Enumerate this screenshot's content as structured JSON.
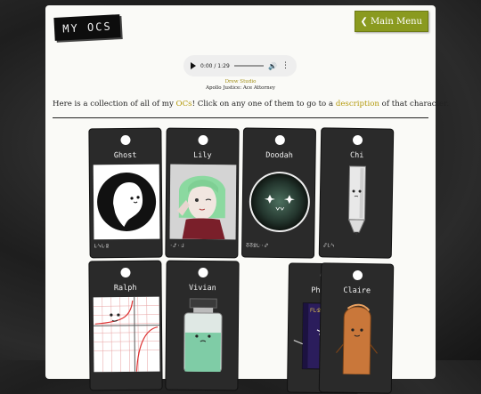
{
  "header": {
    "logo_text": "MY OCS",
    "main_menu_label": "Main Menu",
    "main_menu_icon": "chevron-left-icon"
  },
  "audio": {
    "time": "0:00 / 1:29"
  },
  "credit": {
    "artist": "Drew Studio",
    "song": "Apollo Justice: Ace Attorney"
  },
  "intro": {
    "part1": "Here is a collection of all of my ",
    "link1": "OCs",
    "part2": "! Click on any one of them to go to a ",
    "link2": "description",
    "part3": " of that character."
  },
  "accent_color": "#b3990a",
  "button_color": "#8a9a1f",
  "characters": [
    {
      "name": "Ghost",
      "rune": "ᒷᓭᒷᘖ"
    },
    {
      "name": "Lily",
      "rune": "·ᔑ·ᒲ"
    },
    {
      "name": "Doodah",
      "rune": "ᘔᘔᘖᒷ·ᔑ"
    },
    {
      "name": "Chi",
      "rune": "ᔑᒷᓭ"
    },
    {
      "name": "Ralph",
      "rune": ""
    },
    {
      "name": "Vivian",
      "rune": ""
    },
    {
      "name": "Philip",
      "rune": ""
    },
    {
      "name": "Claire",
      "rune": ""
    }
  ],
  "art_text": {
    "philip_book": "ᖴᒷᘖᔑᒷᔑᓭ"
  }
}
